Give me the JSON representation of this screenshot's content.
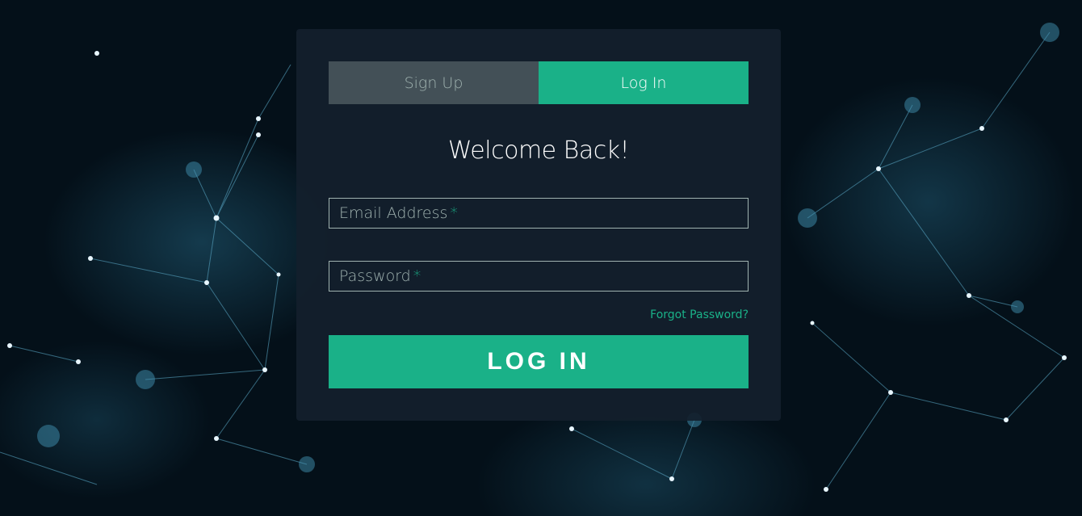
{
  "tabs": [
    {
      "label": "Sign Up",
      "active": false
    },
    {
      "label": "Log In",
      "active": true
    }
  ],
  "heading": "Welcome Back!",
  "form": {
    "email": {
      "placeholder": "Email Address",
      "required_mark": "*",
      "value": ""
    },
    "password": {
      "placeholder": "Password",
      "required_mark": "*",
      "value": ""
    },
    "forgot_link": "Forgot Password?",
    "submit_label": "LOG IN"
  },
  "colors": {
    "accent": "#1ab188",
    "inactive_tab": "#435057",
    "card_bg": "#13202c",
    "muted_text": "#a0b3b0"
  }
}
